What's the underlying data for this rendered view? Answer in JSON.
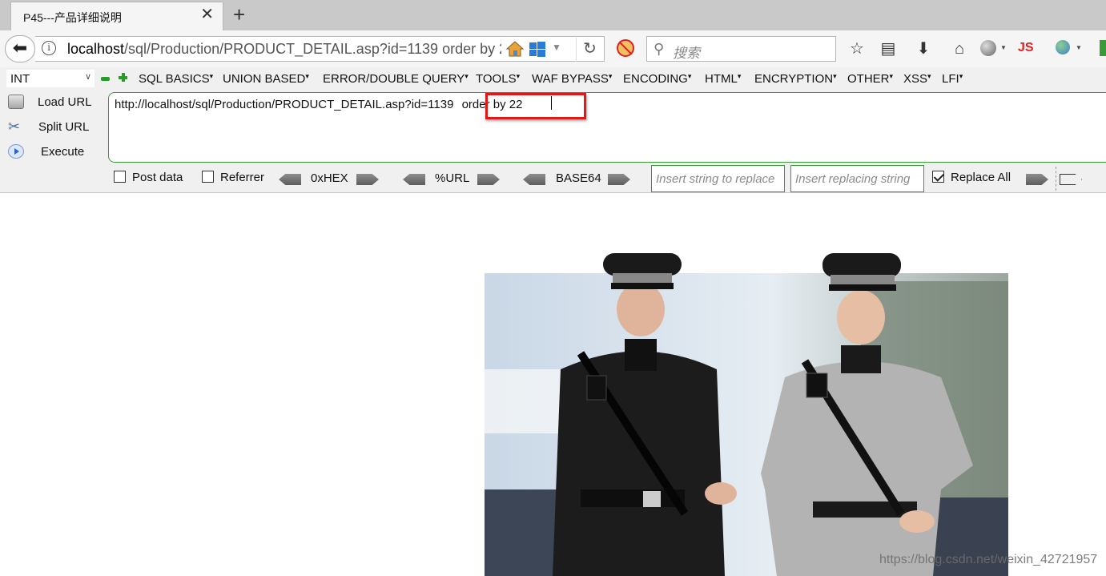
{
  "browser": {
    "tab_title": "P45---产品详细说明",
    "tab_close_icon": "close-icon",
    "new_tab_symbol": "+",
    "address_host": "localhost",
    "address_path": "/sql/Production/PRODUCT_DETAIL.asp?id=1139  order by 22",
    "search_placeholder": "搜索",
    "js_label": "JS"
  },
  "hackbar": {
    "type_select": "INT",
    "menus": [
      "SQL BASICS",
      "UNION BASED",
      "ERROR/DOUBLE QUERY",
      "TOOLS",
      "WAF BYPASS",
      "ENCODING",
      "HTML",
      "ENCRYPTION",
      "OTHER",
      "XSS",
      "LFI"
    ],
    "load_url_label": "Load URL",
    "split_url_label": "Split URL",
    "execute_label": "Execute",
    "url_prefix": "http://localhost/sql/Production/PRODUCT_DETAIL.asp?id=1139 ",
    "url_injection": "order by 22",
    "post_data_label": "Post data",
    "referrer_label": "Referrer",
    "hex_label": "0xHEX",
    "url_enc_label": "%URL",
    "base64_label": "BASE64",
    "replace_find_placeholder": "Insert string to replace",
    "replace_with_placeholder": "Insert replacing string",
    "replace_all_label": "Replace All",
    "replace_all_checked": true,
    "post_data_checked": false,
    "referrer_checked": false
  },
  "page": {
    "watermark": "https://blog.csdn.net/weixin_42721957"
  },
  "colors": {
    "highlight": "#e01818",
    "hackbar_green": "#3a9a3a"
  }
}
